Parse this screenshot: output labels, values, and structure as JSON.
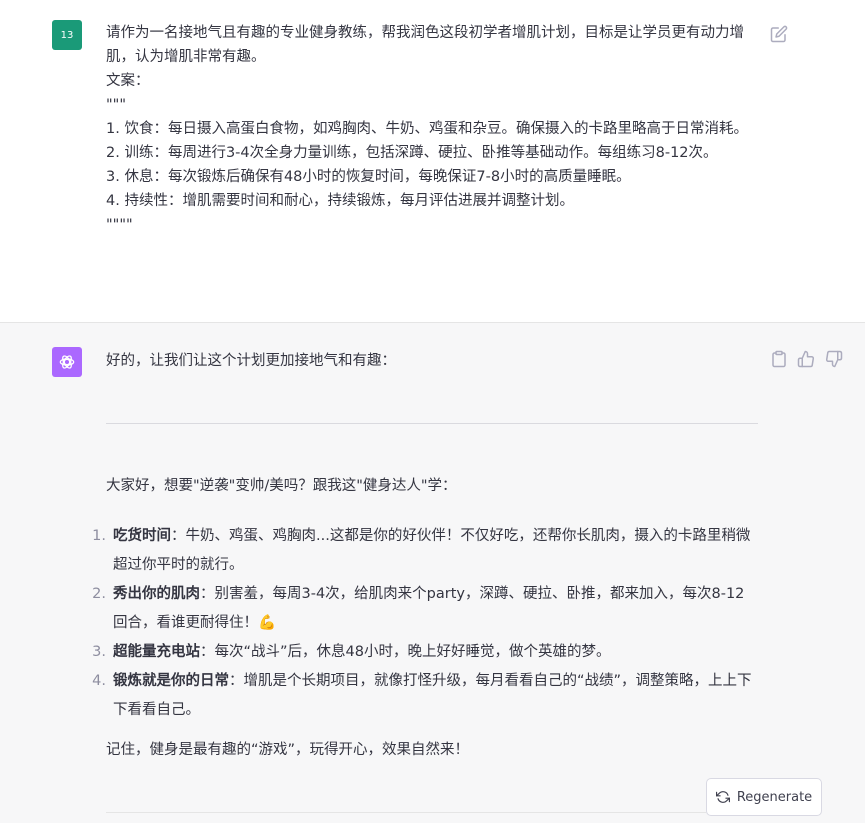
{
  "user_message": {
    "avatar_text": "13",
    "lines": [
      "请作为一名接地气且有趣的专业健身教练，帮我润色这段初学者增肌计划，目标是让学员更有动力增肌，认为增肌非常有趣。",
      "文案：",
      "\"\"\"",
      "1. 饮食：每日摄入高蛋白食物，如鸡胸肉、牛奶、鸡蛋和杂豆。确保摄入的卡路里略高于日常消耗。",
      "2. 训练：每周进行3-4次全身力量训练，包括深蹲、硬拉、卧推等基础动作。每组练习8-12次。",
      "3. 休息：每次锻炼后确保有48小时的恢复时间，每晚保证7-8小时的高质量睡眠。",
      "4. 持续性：增肌需要时间和耐心，持续锻炼，每月评估进展并调整计划。",
      "\"\"\"\""
    ]
  },
  "assistant_message": {
    "intro": "好的，让我们让这个计划更加接地气和有趣：",
    "greeting": "大家好，想要\"逆袭\"变帅/美吗？跟我这\"健身达人\"学：",
    "items": [
      {
        "num": "1.",
        "title": "吃货时间",
        "text": "：牛奶、鸡蛋、鸡胸肉...这都是你的好伙伴！不仅好吃，还帮你长肌肉，摄入的卡路里稍微超过你平时的就行。"
      },
      {
        "num": "2.",
        "title": "秀出你的肌肉",
        "text": "：别害羞，每周3-4次，给肌肉来个party，深蹲、硬拉、卧推，都来加入，每次8-12回合，看谁更耐得住！💪"
      },
      {
        "num": "3.",
        "title": "超能量充电站",
        "text": "：每次“战斗”后，休息48小时，晚上好好睡觉，做个英雄的梦。"
      },
      {
        "num": "4.",
        "title": "锻炼就是你的日常",
        "text": "：增肌是个长期项目，就像打怪升级，每月看看自己的“战绩”，调整策略，上上下下看看自己。"
      }
    ],
    "outro": "记住，健身是最有趣的“游戏”，玩得开心，效果自然来！"
  },
  "regenerate_label": "Regenerate",
  "icons": {
    "edit": "edit-icon",
    "copy": "clipboard-icon",
    "thumb_up": "thumbs-up-icon",
    "thumb_down": "thumbs-down-icon",
    "regenerate": "refresh-icon",
    "assistant_logo": "openai-logo-icon"
  },
  "colors": {
    "user_avatar": "#1a9a78",
    "assistant_avatar": "#ab68ff",
    "assistant_bg": "#f7f7f8"
  }
}
